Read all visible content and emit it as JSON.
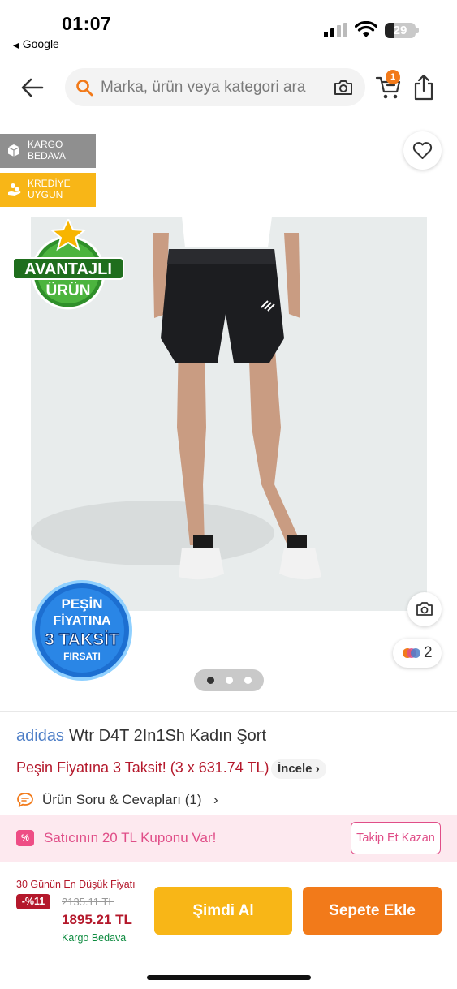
{
  "status_bar": {
    "time": "01:07",
    "back_app": "Google",
    "battery": "29"
  },
  "header": {
    "search_placeholder": "Marka, ürün veya kategori ara",
    "cart_count": "1",
    "icons": [
      "back-arrow-icon",
      "search-icon",
      "camera-icon",
      "cart-icon",
      "share-icon"
    ]
  },
  "gallery": {
    "badges": [
      {
        "label": "KARGO BEDAVA",
        "color": "#8f8f8f"
      },
      {
        "label": "KREDİYE UYGUN",
        "color": "#f8b617"
      }
    ],
    "sticker_top": {
      "line1": "AVANTAJLI",
      "line2": "ÜRÜN"
    },
    "sticker_bottom": {
      "line1": "PEŞİN",
      "line2": "FİYATINA",
      "line3": "3 TAKSİT",
      "line4": "FIRSATI"
    },
    "color_count": "2",
    "pages": 3,
    "active_page": 1
  },
  "product": {
    "brand": "adidas",
    "name": "Wtr D4T 2In1Sh Kadın Şort",
    "installment_text": "Peşin Fiyatına 3 Taksit! (3 x 631.74 TL)",
    "incele_label": "İncele",
    "qa_label": "Ürün Soru & Cevapları (1)"
  },
  "coupon": {
    "icon_text": "%",
    "text": "Satıcının 20 TL Kuponu Var!",
    "follow_label": "Takip Et Kazan"
  },
  "buy_bar": {
    "lowest_label": "30 Günün En Düşük Fiyatı",
    "discount": "-%11",
    "old_price": "2135.11 TL",
    "new_price": "1895.21 TL",
    "shipping": "Kargo Bedava",
    "buy_now_label": "Şimdi Al",
    "add_to_cart_label": "Sepete Ekle"
  },
  "colors": {
    "orange": "#f27a1a",
    "yellow": "#f8b617",
    "red": "#b4182b",
    "pink": "#e04e88",
    "brand_blue": "#4d7ec7"
  }
}
